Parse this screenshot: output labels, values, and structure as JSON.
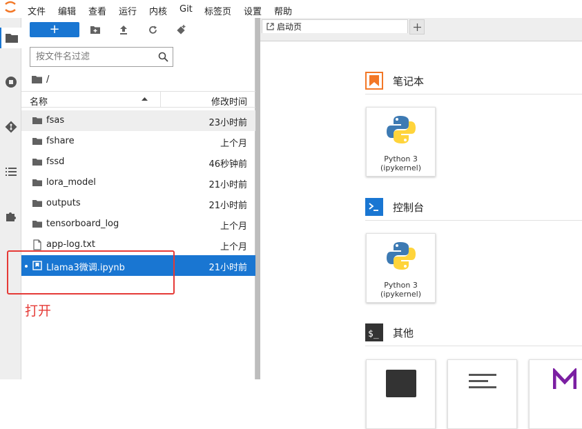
{
  "menu": [
    "文件",
    "编辑",
    "查看",
    "运行",
    "内核",
    "Git",
    "标签页",
    "设置",
    "帮助"
  ],
  "toolbar": {
    "new_label": "+"
  },
  "search": {
    "placeholder": "按文件名过滤"
  },
  "breadcrumb": {
    "path": "/"
  },
  "list_header": {
    "name": "名称",
    "modified": "修改时间"
  },
  "files": [
    {
      "name": "fsas",
      "modified": "23小时前",
      "type": "folder"
    },
    {
      "name": "fshare",
      "modified": "上个月",
      "type": "folder"
    },
    {
      "name": "fssd",
      "modified": "46秒钟前",
      "type": "folder"
    },
    {
      "name": "lora_model",
      "modified": "21小时前",
      "type": "folder"
    },
    {
      "name": "outputs",
      "modified": "21小时前",
      "type": "folder"
    },
    {
      "name": "tensorboard_log",
      "modified": "上个月",
      "type": "folder"
    },
    {
      "name": "app-log.txt",
      "modified": "上个月",
      "type": "file"
    },
    {
      "name": "Llama3微调.ipynb",
      "modified": "21小时前",
      "type": "notebook"
    }
  ],
  "annotation": {
    "text": "打开",
    "color": "#e53935"
  },
  "tab": {
    "label": "启动页"
  },
  "launcher": {
    "notebook": {
      "title": "笔记本",
      "card_line1": "Python 3",
      "card_line2": "(ipykernel)"
    },
    "console": {
      "title": "控制台",
      "card_line1": "Python 3",
      "card_line2": "(ipykernel)"
    },
    "other": {
      "title": "其他"
    }
  },
  "colors": {
    "accent": "#1976d2",
    "notebook_icon": "#f37726",
    "annotation": "#e53935"
  }
}
